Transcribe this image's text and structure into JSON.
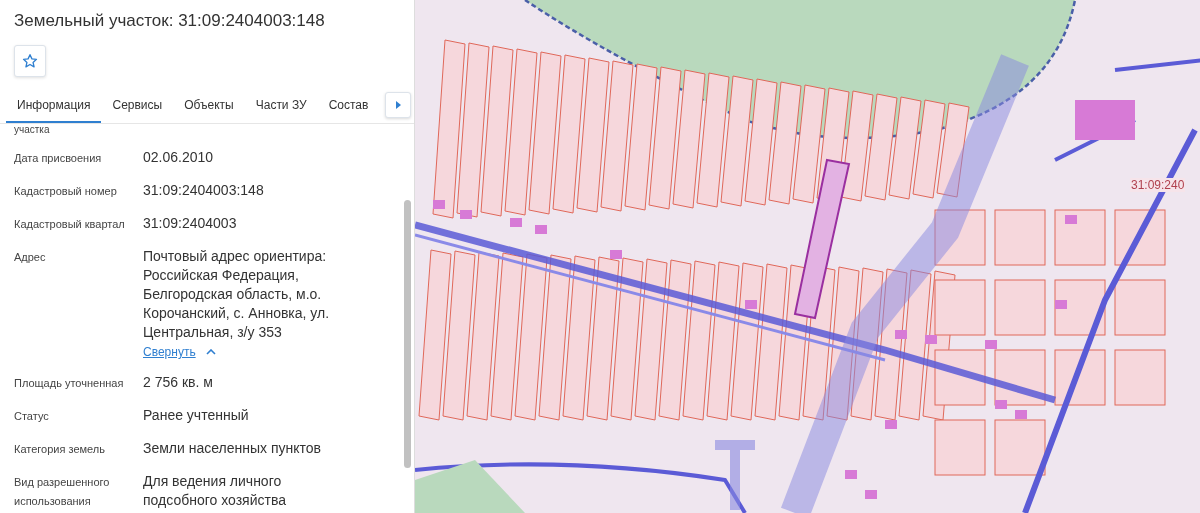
{
  "panel": {
    "title": "Земельный участок: 31:09:2404003:148",
    "favorite": {
      "on": false
    },
    "tabs": [
      {
        "label": "Информация",
        "selected": true
      },
      {
        "label": "Сервисы",
        "selected": false
      },
      {
        "label": "Объекты",
        "selected": false
      },
      {
        "label": "Части ЗУ",
        "selected": false
      },
      {
        "label": "Состав",
        "selected": false
      }
    ],
    "cut_label": "участка",
    "fields": [
      {
        "label": "Дата присвоения",
        "value": "02.06.2010"
      },
      {
        "label": "Кадастровый номер",
        "value": "31:09:2404003:148"
      },
      {
        "label": "Кадастровый квартал",
        "value": "31:09:2404003"
      },
      {
        "label": "Адрес",
        "value": "Почтовый адрес ориентира: Российская Федерация, Белгородская область, м.о. Корочанский, с. Анновка, ул. Центральная, з/у 353",
        "link": "Свернуть"
      },
      {
        "label": "Площадь уточненная",
        "value": "2 756 кв. м"
      },
      {
        "label": "Статус",
        "value": "Ранее учтенный"
      },
      {
        "label": "Категория земель",
        "value": "Земли населенных пунктов"
      },
      {
        "label": "Вид разрешенного использования",
        "value": "Для ведения личного подсобного хозяйства"
      }
    ]
  },
  "map": {
    "quarter_label": "31:09:240"
  }
}
